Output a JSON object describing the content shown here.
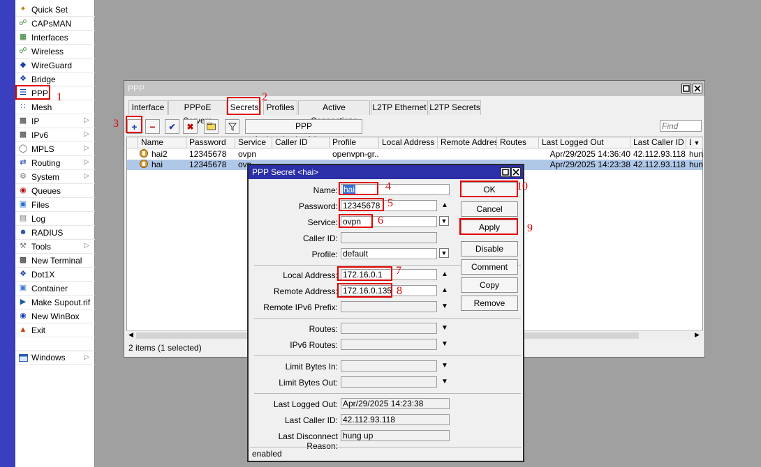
{
  "sidebar": {
    "items": [
      {
        "label": "Quick Set",
        "icon": "wand-icon",
        "submenu": false
      },
      {
        "label": "CAPsMAN",
        "icon": "antenna-icon",
        "submenu": false
      },
      {
        "label": "Interfaces",
        "icon": "interfaces-icon",
        "submenu": false
      },
      {
        "label": "Wireless",
        "icon": "wireless-icon",
        "submenu": false
      },
      {
        "label": "WireGuard",
        "icon": "wireguard-icon",
        "submenu": false
      },
      {
        "label": "Bridge",
        "icon": "bridge-icon",
        "submenu": false
      },
      {
        "label": "PPP",
        "icon": "ppp-icon",
        "submenu": false
      },
      {
        "label": "Mesh",
        "icon": "mesh-icon",
        "submenu": false
      },
      {
        "label": "IP",
        "icon": "ip-icon",
        "submenu": true
      },
      {
        "label": "IPv6",
        "icon": "ipv6-icon",
        "submenu": true
      },
      {
        "label": "MPLS",
        "icon": "mpls-icon",
        "submenu": true
      },
      {
        "label": "Routing",
        "icon": "routing-icon",
        "submenu": true
      },
      {
        "label": "System",
        "icon": "system-gear-icon",
        "submenu": true
      },
      {
        "label": "Queues",
        "icon": "queues-icon",
        "submenu": false
      },
      {
        "label": "Files",
        "icon": "folder-icon",
        "submenu": false
      },
      {
        "label": "Log",
        "icon": "log-icon",
        "submenu": false
      },
      {
        "label": "RADIUS",
        "icon": "radius-icon",
        "submenu": false
      },
      {
        "label": "Tools",
        "icon": "tools-icon",
        "submenu": true
      },
      {
        "label": "New Terminal",
        "icon": "terminal-icon",
        "submenu": false
      },
      {
        "label": "Dot1X",
        "icon": "dot1x-icon",
        "submenu": false
      },
      {
        "label": "Container",
        "icon": "container-icon",
        "submenu": false
      },
      {
        "label": "Make Supout.rif",
        "icon": "supout-icon",
        "submenu": false
      },
      {
        "label": "New WinBox",
        "icon": "winbox-icon",
        "submenu": false
      },
      {
        "label": "Exit",
        "icon": "exit-icon",
        "submenu": false
      }
    ],
    "windows_label": "Windows"
  },
  "ppp_window": {
    "title": "PPP",
    "tabs": [
      "Interface",
      "PPPoE Servers",
      "Secrets",
      "Profiles",
      "Active Connections",
      "L2TP Ethernet",
      "L2TP Secrets"
    ],
    "active_tab": "Secrets",
    "toolbar": {
      "add_icon": "+",
      "remove_icon": "−",
      "enable_icon": "✔",
      "disable_icon": "✖",
      "comment_icon": "comment-icon",
      "filter_icon": "filter-icon",
      "auth_button": "PPP Authentication&Accounting",
      "find_placeholder": "Find"
    },
    "columns": [
      "Name",
      "Password",
      "Service",
      "Caller ID",
      "Profile",
      "Local Address",
      "Remote Address",
      "Routes",
      "Last Logged Out",
      "Last Caller ID",
      "La"
    ],
    "rows": [
      {
        "name": "hai2",
        "password": "12345678",
        "service": "ovpn",
        "caller_id": "",
        "profile": "openvpn-gr...",
        "local_address": "",
        "remote_address": "",
        "routes": "",
        "last_logged_out": "Apr/29/2025 14:36:40",
        "last_caller_id": "42.112.93.118",
        "last_disconnect": "hung"
      },
      {
        "name": "hai",
        "password": "12345678",
        "service": "ovp",
        "caller_id": "",
        "profile": "",
        "local_address": "",
        "remote_address": "",
        "routes": "",
        "last_logged_out": "Apr/29/2025 14:23:38",
        "last_caller_id": "42.112.93.118",
        "last_disconnect": "hung"
      }
    ],
    "status": "2 items (1 selected)"
  },
  "secret_dialog": {
    "title": "PPP Secret <hai>",
    "fields": {
      "name": {
        "label": "Name:",
        "value": "hai"
      },
      "password": {
        "label": "Password:",
        "value": "12345678"
      },
      "service": {
        "label": "Service:",
        "value": "ovpn"
      },
      "caller_id": {
        "label": "Caller ID:",
        "value": ""
      },
      "profile": {
        "label": "Profile:",
        "value": "default"
      },
      "local_address": {
        "label": "Local Address:",
        "value": "172.16.0.1"
      },
      "remote_address": {
        "label": "Remote Address:",
        "value": "172.16.0.135"
      },
      "remote_ipv6_prefix": {
        "label": "Remote IPv6 Prefix:",
        "value": ""
      },
      "routes": {
        "label": "Routes:",
        "value": ""
      },
      "ipv6_routes": {
        "label": "IPv6 Routes:",
        "value": ""
      },
      "limit_bytes_in": {
        "label": "Limit Bytes In:",
        "value": ""
      },
      "limit_bytes_out": {
        "label": "Limit Bytes Out:",
        "value": ""
      },
      "last_logged_out": {
        "label": "Last Logged Out:",
        "value": "Apr/29/2025 14:23:38"
      },
      "last_caller_id": {
        "label": "Last Caller ID:",
        "value": "42.112.93.118"
      },
      "last_disconnect_reason": {
        "label": "Last Disconnect Reason:",
        "value": "hung up"
      }
    },
    "buttons": {
      "ok": "OK",
      "cancel": "Cancel",
      "apply": "Apply",
      "disable": "Disable",
      "comment": "Comment",
      "copy": "Copy",
      "remove": "Remove"
    },
    "status": "enabled"
  },
  "annotations": [
    "1",
    "2",
    "3",
    "4",
    "5",
    "6",
    "7",
    "8",
    "9",
    "10"
  ],
  "colors": {
    "brand_strip": "#3a3fbf",
    "dialog_title": "#2b30a8",
    "annotation": "#e00000",
    "selected_row": "#b0c8e8"
  }
}
